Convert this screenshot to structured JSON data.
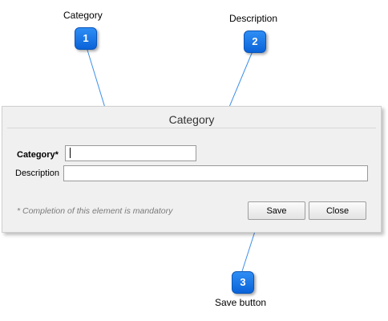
{
  "callouts": [
    {
      "number": "1",
      "label": "Category"
    },
    {
      "number": "2",
      "label": "Description"
    },
    {
      "number": "3",
      "label": "Save button"
    }
  ],
  "dialog": {
    "title": "Category",
    "fields": {
      "category": {
        "label": "Category*",
        "value": ""
      },
      "description": {
        "label": "Description",
        "value": ""
      }
    },
    "mandatory_note": "* Completion of this element is mandatory",
    "buttons": {
      "save_label": "Save",
      "close_label": "Close"
    }
  }
}
